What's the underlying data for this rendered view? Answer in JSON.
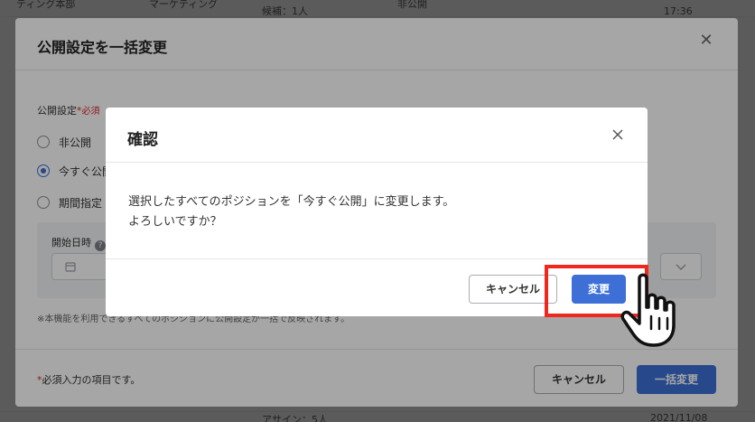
{
  "background": {
    "top_left": "ティング本部",
    "top_mid": "マーケティング",
    "top_count": "候補：1人",
    "top_badge": "非公開",
    "top_time": "17:36",
    "bottom_count": "アサイン：5人",
    "bottom_date": "2021/11/08"
  },
  "outer_modal": {
    "title": "公開設定を一括変更",
    "field_label": "公開設定",
    "required_mark": "*",
    "required_text": "必須",
    "options": [
      "非公開",
      "今すぐ公開",
      "期間指定"
    ],
    "selected_index": 1,
    "start_label": "開始日時",
    "help_symbol": "?",
    "note": "※本機能を利用できるすべてのポジションに公開設定が一括で反映されます。",
    "footer_note_mark": "*",
    "footer_note": "必須入力の項目です。",
    "cancel_label": "キャンセル",
    "submit_label": "一括変更"
  },
  "confirm_dialog": {
    "title": "確認",
    "message_line1": "選択したすべてのポジションを「今すぐ公開」に変更します。",
    "message_line2": "よろしいですか？",
    "cancel_label": "キャンセル",
    "confirm_label": "変更"
  },
  "colors": {
    "primary": "#3d6fd6",
    "highlight": "#f0271d",
    "required": "#e0262b"
  }
}
